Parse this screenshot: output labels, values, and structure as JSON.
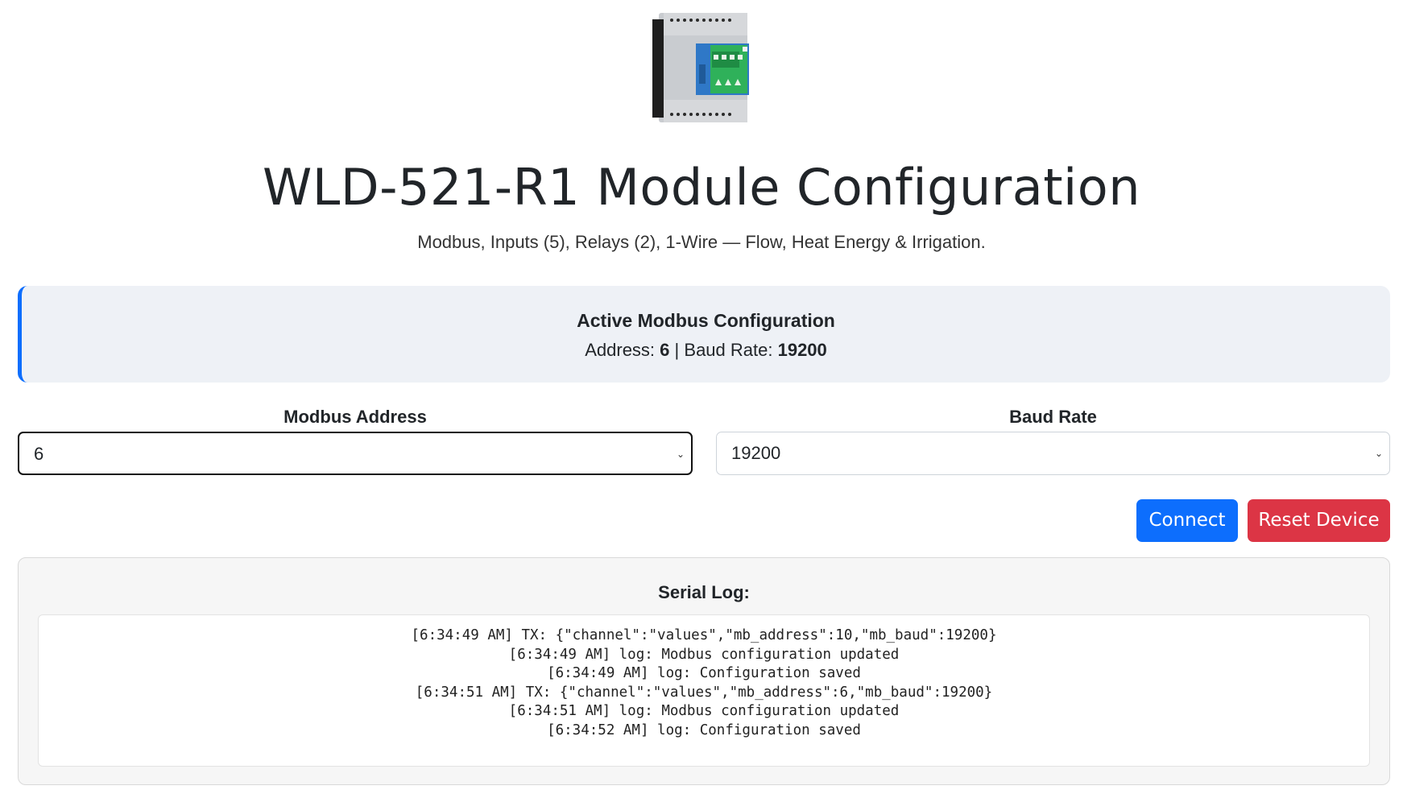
{
  "header": {
    "title": "WLD-521-R1 Module Configuration",
    "subtitle": "Modbus, Inputs (5), Relays (2), 1-Wire — Flow, Heat Energy & Irrigation."
  },
  "active_config": {
    "title": "Active Modbus Configuration",
    "address_label": "Address:",
    "address_value": "6",
    "separator": "|",
    "baud_label": "Baud Rate:",
    "baud_value": "19200"
  },
  "form": {
    "address_label": "Modbus Address",
    "address_selected": "6",
    "baud_label": "Baud Rate",
    "baud_selected": "19200"
  },
  "buttons": {
    "connect": "Connect",
    "reset": "Reset Device"
  },
  "log": {
    "title": "Serial Log:",
    "lines": [
      "[6:34:49 AM] TX: {\"channel\":\"values\",\"mb_address\":10,\"mb_baud\":19200}",
      "[6:34:49 AM] log: Modbus configuration updated",
      "[6:34:49 AM] log: Configuration saved",
      "[6:34:51 AM] TX: {\"channel\":\"values\",\"mb_address\":6,\"mb_baud\":19200}",
      "[6:34:51 AM] log: Modbus configuration updated",
      "[6:34:52 AM] log: Configuration saved"
    ]
  },
  "colors": {
    "primary": "#0d6efd",
    "danger": "#dc3545",
    "banner_bg": "#eef1f6"
  },
  "icons": {
    "device_image": "din-rail-module-image",
    "select_arrow": "chevron-down-icon"
  }
}
